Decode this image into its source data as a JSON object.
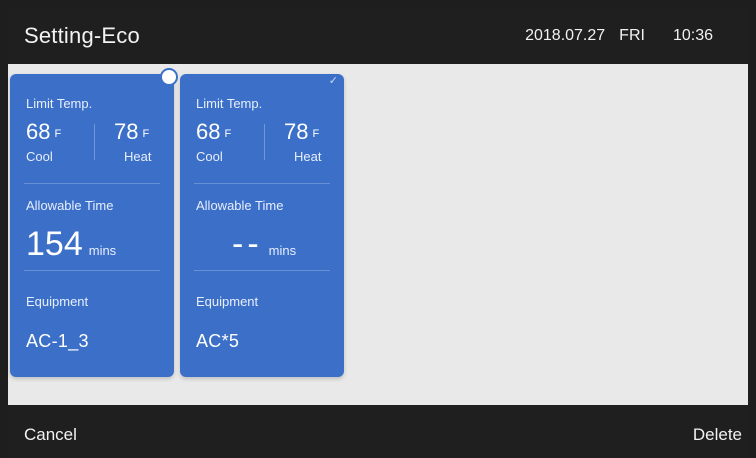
{
  "header": {
    "title": "Setting-Eco",
    "date": "2018.07.27",
    "weekday": "FRI",
    "time": "10:36"
  },
  "colors": {
    "card": "#3c70c8",
    "background": "#e9e9e9",
    "bar": "#1f1f1f"
  },
  "cards": [
    {
      "limit_temp_label": "Limit Temp.",
      "cool_value": "68",
      "cool_unit": "F",
      "cool_label": "Cool",
      "heat_value": "78",
      "heat_unit": "F",
      "heat_label": "Heat",
      "allowable_time_label": "Allowable Time",
      "time_value": "154",
      "time_unit": "mins",
      "equipment_label": "Equipment",
      "equipment_value": "AC-1_3",
      "selected": true
    },
    {
      "limit_temp_label": "Limit Temp.",
      "cool_value": "68",
      "cool_unit": "F",
      "cool_label": "Cool",
      "heat_value": "78",
      "heat_unit": "F",
      "heat_label": "Heat",
      "allowable_time_label": "Allowable Time",
      "time_value": "--",
      "time_unit": "mins",
      "equipment_label": "Equipment",
      "equipment_value": "AC*5",
      "check_icon": "check-icon",
      "selected": false
    }
  ],
  "footer": {
    "cancel_label": "Cancel",
    "delete_label": "Delete"
  }
}
